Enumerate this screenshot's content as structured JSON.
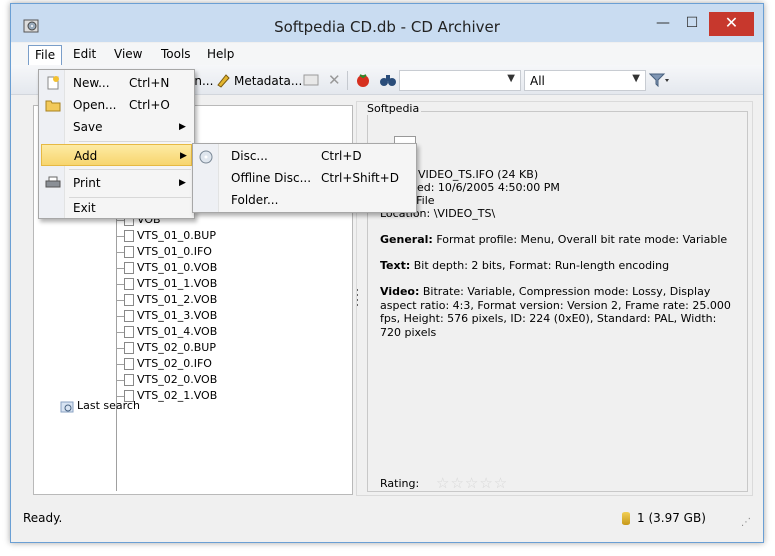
{
  "window": {
    "title": "Softpedia CD.db - CD Archiver",
    "minimize": "—",
    "maximize": "☐",
    "close": "✕"
  },
  "menubar": [
    "File",
    "Edit",
    "View",
    "Tools",
    "Help"
  ],
  "toolbar": {
    "scan_fragment": "an...",
    "metadata": "Metadata...",
    "search_value": "",
    "filter_value": "All"
  },
  "file_menu": {
    "new": {
      "label": "New...",
      "shortcut": "Ctrl+N"
    },
    "open": {
      "label": "Open...",
      "shortcut": "Ctrl+O"
    },
    "save": {
      "label": "Save"
    },
    "add": {
      "label": "Add"
    },
    "print": {
      "label": "Print"
    },
    "exit": {
      "label": "Exit"
    }
  },
  "add_submenu": {
    "disc": {
      "label": "Disc...",
      "shortcut": "Ctrl+D"
    },
    "offline": {
      "label": "Offline Disc...",
      "shortcut": "Ctrl+Shift+D"
    },
    "folder": {
      "label": "Folder..."
    }
  },
  "tree": {
    "files": [
      "VOB",
      "VTS_01_0.BUP",
      "VTS_01_0.IFO",
      "VTS_01_0.VOB",
      "VTS_01_1.VOB",
      "VTS_01_2.VOB",
      "VTS_01_3.VOB",
      "VTS_01_4.VOB",
      "VTS_02_0.BUP",
      "VTS_02_0.IFO",
      "VTS_02_0.VOB",
      "VTS_02_1.VOB"
    ],
    "last_search": "Last search"
  },
  "details": {
    "group": "Softpedia",
    "name_line": "VIDEO_TS.IFO (24 KB)",
    "modified_line": "dified: 10/6/2005 4:50:00 PM",
    "type_line": "O File",
    "location_line": "Location: \\VIDEO_TS\\",
    "general_label": "General:",
    "general_text": "Format profile: Menu, Overall bit rate mode: Variable",
    "text_label": "Text:",
    "text_text": "Bit depth: 2 bits, Format: Run-length encoding",
    "video_label": "Video:",
    "video_text": "Bitrate: Variable, Compression mode: Lossy, Display aspect ratio: 4:3, Format version: Version 2, Frame rate: 25.000 fps, Height: 576 pixels, ID: 224 (0xE0), Standard: PAL, Width: 720 pixels",
    "rating_label": "Rating:",
    "rating_value": 0,
    "rating_max": 5
  },
  "status": {
    "text": "Ready.",
    "count": "1 (3.97 GB)"
  }
}
